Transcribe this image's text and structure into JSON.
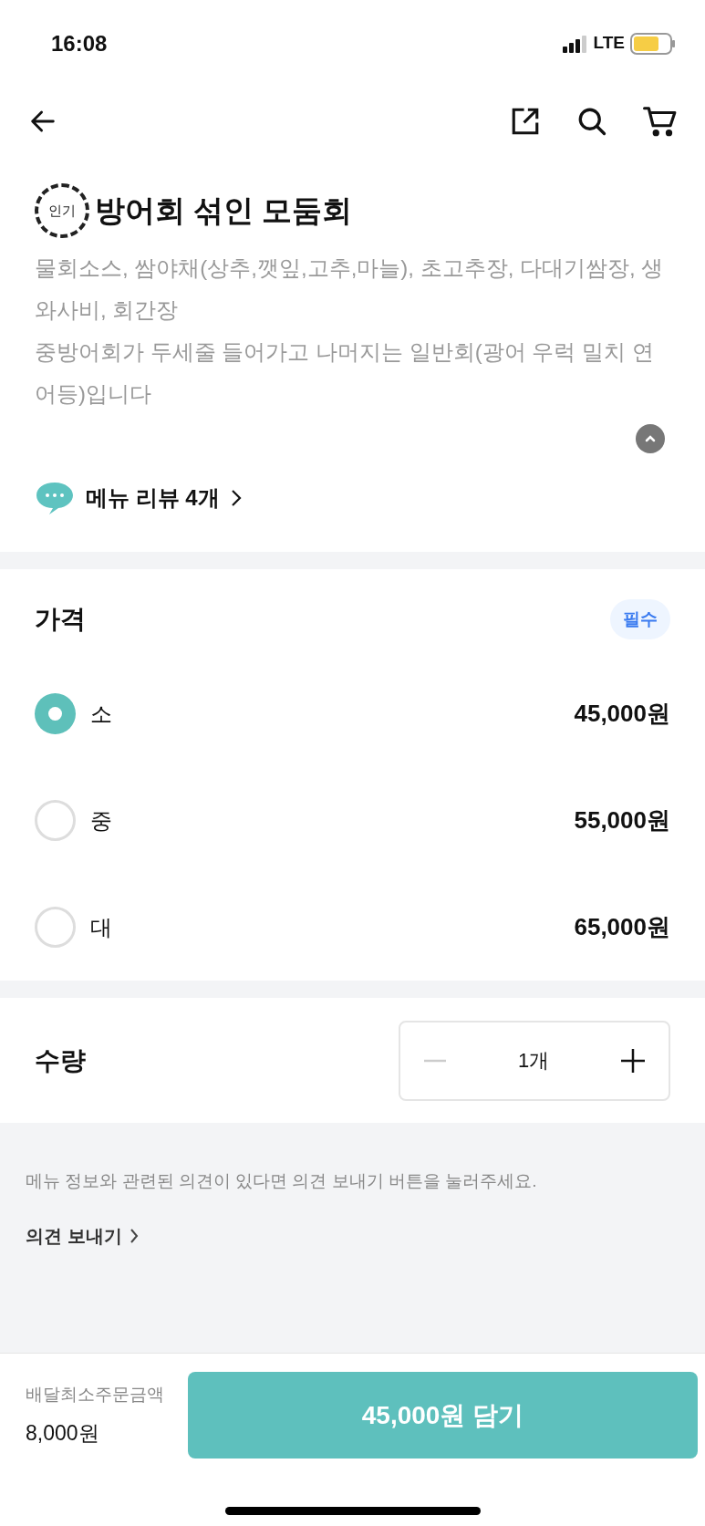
{
  "status_bar": {
    "time": "16:08",
    "network": "LTE"
  },
  "menu": {
    "badge": "인기",
    "title": "방어회 섞인 모둠회",
    "description_lines": [
      "물회소스, 쌈야채(상추,깻잎,고추,마늘), 초고추장, 다대기쌈장, 생와사비, 회간장",
      "중방어회가 두세줄 들어가고 나머지는 일반회(광어 우럭 밀치 연어등)입니다"
    ],
    "expanded": true,
    "review_link": "메뉴 리뷰 4개"
  },
  "price": {
    "title": "가격",
    "required_badge": "필수",
    "options": [
      {
        "label": "소",
        "price": "45,000원",
        "selected": true
      },
      {
        "label": "중",
        "price": "55,000원",
        "selected": false
      },
      {
        "label": "대",
        "price": "65,000원",
        "selected": false
      }
    ]
  },
  "quantity": {
    "title": "수량",
    "value": "1개",
    "minus_disabled": true
  },
  "feedback": {
    "text": "메뉴 정보와 관련된 의견이 있다면 의견 보내기 버튼을 눌러주세요.",
    "link": "의견 보내기"
  },
  "footer": {
    "min_order_label": "배달최소주문금액",
    "min_order_value": "8,000원",
    "add_button": "45,000원 담기"
  }
}
